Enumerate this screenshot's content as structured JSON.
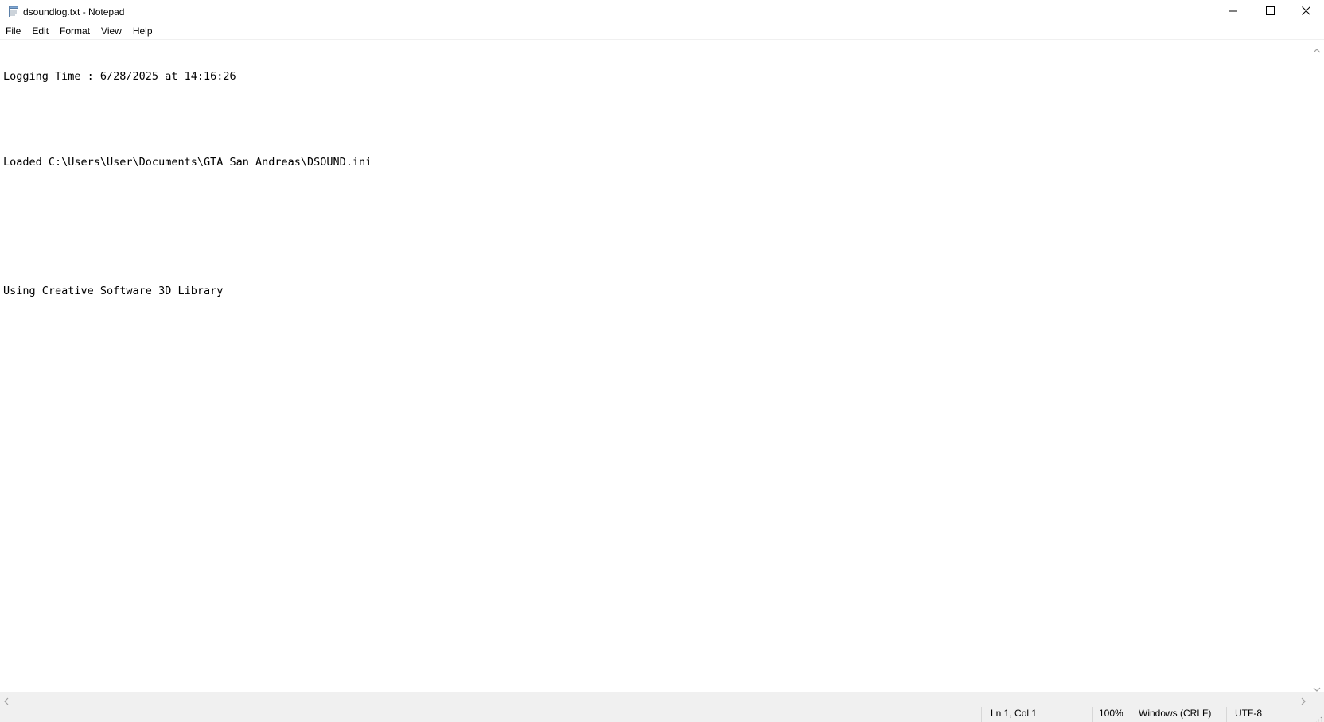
{
  "window": {
    "title": "dsoundlog.txt - Notepad",
    "app_icon": "notepad-icon",
    "controls": [
      "minimize-icon",
      "maximize-icon",
      "close-icon"
    ]
  },
  "menu": {
    "items": [
      {
        "label": "File"
      },
      {
        "label": "Edit"
      },
      {
        "label": "Format"
      },
      {
        "label": "View"
      },
      {
        "label": "Help"
      }
    ]
  },
  "editor": {
    "lines": [
      "Logging Time : 6/28/2025 at 14:16:26",
      "",
      "Loaded C:\\Users\\User\\Documents\\GTA San Andreas\\DSOUND.ini",
      "",
      "",
      "Using Creative Software 3D Library"
    ]
  },
  "status": {
    "position": "Ln 1, Col 1",
    "zoom": "100%",
    "line_ending": "Windows (CRLF)",
    "encoding": "UTF-8"
  },
  "colors": {
    "background": "#ffffff",
    "chrome": "#f0f0f0",
    "text": "#000000"
  }
}
